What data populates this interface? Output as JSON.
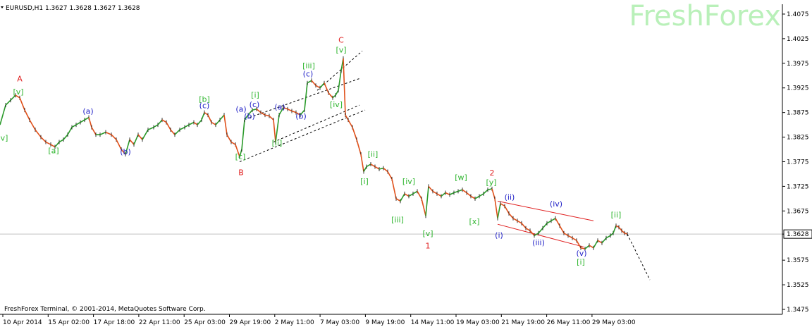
{
  "header": {
    "symbol_line": "EURUSD,H1  1.3627 1.3628 1.3627 1.3628"
  },
  "brand": {
    "logo_text": "FreshForex"
  },
  "footer": {
    "copyright": "FreshForex Terminal, © 2001-2014, MetaQuotes Software Corp."
  },
  "colors": {
    "bar_up": "#2a9a2a",
    "bar_down": "#e0501a",
    "wave_green": "#2db52d",
    "wave_blue": "#2424c8",
    "wave_red": "#e02020",
    "channel_red": "#e02020",
    "axis": "#000000",
    "brand": "#b9f0b9"
  },
  "chart_data": {
    "type": "line",
    "title": "EURUSD,H1",
    "ylim": [
      1.3465,
      1.4095
    ],
    "y_ticks": [
      "1.4075",
      "1.4025",
      "1.3975",
      "1.3925",
      "1.3875",
      "1.3825",
      "1.3775",
      "1.3725",
      "1.3675",
      "1.3628",
      "1.3575",
      "1.3525",
      "1.3475"
    ],
    "current_price": "1.3628",
    "x_ticks": [
      "10 Apr 2014",
      "15 Apr 02:00",
      "17 Apr 18:00",
      "22 Apr 11:00",
      "25 Apr 03:00",
      "29 Apr 19:00",
      "2 May 11:00",
      "7 May 03:00",
      "9 May 19:00",
      "14 May 11:00",
      "19 May 03:00",
      "21 May 19:00",
      "26 May 11:00",
      "29 May 03:00"
    ],
    "x_range": [
      0,
      1110
    ],
    "series": [
      {
        "values": [
          [
            0,
            1.385
          ],
          [
            8,
            1.389
          ],
          [
            15,
            1.39
          ],
          [
            22,
            1.391
          ],
          [
            28,
            1.3905
          ],
          [
            35,
            1.388
          ],
          [
            42,
            1.386
          ],
          [
            50,
            1.384
          ],
          [
            58,
            1.3825
          ],
          [
            65,
            1.3815
          ],
          [
            72,
            1.381
          ],
          [
            78,
            1.3805
          ],
          [
            84,
            1.3815
          ],
          [
            90,
            1.382
          ],
          [
            96,
            1.383
          ],
          [
            102,
            1.3845
          ],
          [
            108,
            1.385
          ],
          [
            114,
            1.3855
          ],
          [
            120,
            1.386
          ],
          [
            126,
            1.3865
          ],
          [
            130,
            1.3845
          ],
          [
            136,
            1.383
          ],
          [
            142,
            1.383
          ],
          [
            150,
            1.3835
          ],
          [
            158,
            1.383
          ],
          [
            165,
            1.382
          ],
          [
            172,
            1.38
          ],
          [
            178,
            1.379
          ],
          [
            184,
            1.382
          ],
          [
            190,
            1.381
          ],
          [
            196,
            1.383
          ],
          [
            202,
            1.382
          ],
          [
            210,
            1.384
          ],
          [
            218,
            1.3845
          ],
          [
            224,
            1.385
          ],
          [
            230,
            1.386
          ],
          [
            236,
            1.3855
          ],
          [
            242,
            1.384
          ],
          [
            248,
            1.383
          ],
          [
            255,
            1.384
          ],
          [
            262,
            1.3845
          ],
          [
            268,
            1.385
          ],
          [
            275,
            1.3855
          ],
          [
            280,
            1.385
          ],
          [
            286,
            1.386
          ],
          [
            290,
            1.3875
          ],
          [
            295,
            1.387
          ],
          [
            300,
            1.3855
          ],
          [
            306,
            1.385
          ],
          [
            312,
            1.386
          ],
          [
            318,
            1.387
          ],
          [
            322,
            1.383
          ],
          [
            328,
            1.3815
          ],
          [
            334,
            1.381
          ],
          [
            340,
            1.3785
          ],
          [
            343,
            1.38
          ],
          [
            347,
            1.386
          ],
          [
            352,
            1.387
          ],
          [
            358,
            1.388
          ],
          [
            364,
            1.3882
          ],
          [
            370,
            1.3875
          ],
          [
            376,
            1.387
          ],
          [
            382,
            1.3868
          ],
          [
            388,
            1.386
          ],
          [
            391,
            1.3815
          ],
          [
            396,
            1.387
          ],
          [
            402,
            1.3885
          ],
          [
            408,
            1.3882
          ],
          [
            414,
            1.3878
          ],
          [
            420,
            1.3875
          ],
          [
            426,
            1.387
          ],
          [
            432,
            1.388
          ],
          [
            436,
            1.3935
          ],
          [
            442,
            1.394
          ],
          [
            448,
            1.393
          ],
          [
            454,
            1.3925
          ],
          [
            460,
            1.3935
          ],
          [
            466,
            1.3915
          ],
          [
            472,
            1.3905
          ],
          [
            476,
            1.391
          ],
          [
            480,
            1.392
          ],
          [
            484,
            1.396
          ],
          [
            487,
            1.3985
          ],
          [
            490,
            1.387
          ],
          [
            494,
            1.386
          ],
          [
            500,
            1.3845
          ],
          [
            506,
            1.382
          ],
          [
            512,
            1.379
          ],
          [
            516,
            1.3755
          ],
          [
            520,
            1.3765
          ],
          [
            526,
            1.377
          ],
          [
            532,
            1.3765
          ],
          [
            538,
            1.376
          ],
          [
            544,
            1.3762
          ],
          [
            550,
            1.3755
          ],
          [
            556,
            1.374
          ],
          [
            562,
            1.37
          ],
          [
            568,
            1.3695
          ],
          [
            574,
            1.371
          ],
          [
            580,
            1.3705
          ],
          [
            586,
            1.371
          ],
          [
            592,
            1.3715
          ],
          [
            598,
            1.37
          ],
          [
            604,
            1.3665
          ],
          [
            608,
            1.3725
          ],
          [
            614,
            1.3715
          ],
          [
            620,
            1.371
          ],
          [
            626,
            1.3705
          ],
          [
            632,
            1.3712
          ],
          [
            638,
            1.3708
          ],
          [
            644,
            1.3712
          ],
          [
            650,
            1.3715
          ],
          [
            656,
            1.3718
          ],
          [
            662,
            1.3712
          ],
          [
            668,
            1.3705
          ],
          [
            674,
            1.37
          ],
          [
            680,
            1.3705
          ],
          [
            686,
            1.371
          ],
          [
            692,
            1.3718
          ],
          [
            698,
            1.372
          ],
          [
            702,
            1.37
          ],
          [
            706,
            1.366
          ],
          [
            710,
            1.369
          ],
          [
            716,
            1.3685
          ],
          [
            722,
            1.367
          ],
          [
            728,
            1.366
          ],
          [
            734,
            1.3655
          ],
          [
            740,
            1.365
          ],
          [
            746,
            1.364
          ],
          [
            752,
            1.3635
          ],
          [
            758,
            1.3625
          ],
          [
            764,
            1.363
          ],
          [
            770,
            1.364
          ],
          [
            776,
            1.365
          ],
          [
            782,
            1.3655
          ],
          [
            788,
            1.366
          ],
          [
            794,
            1.3645
          ],
          [
            800,
            1.363
          ],
          [
            806,
            1.3625
          ],
          [
            812,
            1.362
          ],
          [
            818,
            1.3615
          ],
          [
            824,
            1.36
          ],
          [
            830,
            1.3598
          ],
          [
            836,
            1.3605
          ],
          [
            842,
            1.36
          ],
          [
            848,
            1.3615
          ],
          [
            854,
            1.361
          ],
          [
            860,
            1.362
          ],
          [
            866,
            1.3625
          ],
          [
            870,
            1.363
          ],
          [
            874,
            1.3645
          ],
          [
            878,
            1.3642
          ],
          [
            882,
            1.3635
          ],
          [
            886,
            1.363
          ],
          [
            890,
            1.3628
          ]
        ]
      }
    ],
    "forecast": [
      [
        890,
        1.3628
      ],
      [
        922,
        1.3535
      ]
    ],
    "channels": [
      {
        "color": "black",
        "style": "dashed",
        "points": [
          [
            340,
            1.3775
          ],
          [
            518,
            1.388
          ]
        ]
      },
      {
        "color": "black",
        "style": "dashed",
        "points": [
          [
            354,
            1.3865
          ],
          [
            512,
            1.3945
          ]
        ]
      },
      {
        "color": "black",
        "style": "dashed",
        "points": [
          [
            388,
            1.3815
          ],
          [
            510,
            1.389
          ]
        ]
      },
      {
        "color": "black",
        "style": "dashed",
        "points": [
          [
            450,
            1.392
          ],
          [
            514,
            1.4
          ]
        ]
      },
      {
        "color": "red",
        "style": "solid",
        "points": [
          [
            706,
            1.3695
          ],
          [
            842,
            1.3655
          ]
        ]
      },
      {
        "color": "red",
        "style": "solid",
        "points": [
          [
            706,
            1.3648
          ],
          [
            828,
            1.3602
          ]
        ]
      }
    ],
    "annotations": [
      {
        "text": "A",
        "x": 28,
        "y": 1.3938,
        "color": "red"
      },
      {
        "text": "[v]",
        "x": 26,
        "y": 1.3912,
        "color": "green"
      },
      {
        "text": "v]",
        "x": 6,
        "y": 1.3818,
        "color": "green"
      },
      {
        "text": "[a]",
        "x": 76,
        "y": 1.3792,
        "color": "green"
      },
      {
        "text": "(a)",
        "x": 125,
        "y": 1.3872,
        "color": "blue"
      },
      {
        "text": "(b)",
        "x": 178,
        "y": 1.379,
        "color": "blue"
      },
      {
        "text": "[b]",
        "x": 290,
        "y": 1.3897,
        "color": "green"
      },
      {
        "text": "(c)",
        "x": 290,
        "y": 1.3884,
        "color": "blue"
      },
      {
        "text": "[c]",
        "x": 341,
        "y": 1.378,
        "color": "green"
      },
      {
        "text": "B",
        "x": 342,
        "y": 1.3748,
        "color": "red"
      },
      {
        "text": "(a)",
        "x": 342,
        "y": 1.3877,
        "color": "blue"
      },
      {
        "text": "(b)",
        "x": 354,
        "y": 1.3862,
        "color": "blue"
      },
      {
        "text": "(c)",
        "x": 361,
        "y": 1.3886,
        "color": "blue"
      },
      {
        "text": "[i]",
        "x": 362,
        "y": 1.3905,
        "color": "green"
      },
      {
        "text": "[ii]",
        "x": 393,
        "y": 1.3808,
        "color": "green"
      },
      {
        "text": "(a)",
        "x": 397,
        "y": 1.3881,
        "color": "blue"
      },
      {
        "text": "(b)",
        "x": 427,
        "y": 1.3862,
        "color": "blue"
      },
      {
        "text": "[iii]",
        "x": 438,
        "y": 1.3965,
        "color": "green"
      },
      {
        "text": "(c)",
        "x": 437,
        "y": 1.3948,
        "color": "blue"
      },
      {
        "text": "[iv]",
        "x": 477,
        "y": 1.3886,
        "color": "green"
      },
      {
        "text": "C",
        "x": 484,
        "y": 1.4017,
        "color": "red"
      },
      {
        "text": "[v]",
        "x": 484,
        "y": 1.3997,
        "color": "green"
      },
      {
        "text": "[i]",
        "x": 517,
        "y": 1.373,
        "color": "green"
      },
      {
        "text": "[ii]",
        "x": 529,
        "y": 1.3785,
        "color": "green"
      },
      {
        "text": "[iii]",
        "x": 564,
        "y": 1.3652,
        "color": "green"
      },
      {
        "text": "[iv]",
        "x": 580,
        "y": 1.373,
        "color": "green"
      },
      {
        "text": "[v]",
        "x": 607,
        "y": 1.3624,
        "color": "green"
      },
      {
        "text": "1",
        "x": 607,
        "y": 1.3599,
        "color": "red"
      },
      {
        "text": "[w]",
        "x": 654,
        "y": 1.3738,
        "color": "green"
      },
      {
        "text": "[x]",
        "x": 673,
        "y": 1.3648,
        "color": "green"
      },
      {
        "text": "2",
        "x": 698,
        "y": 1.3747,
        "color": "red"
      },
      {
        "text": "[y]",
        "x": 697,
        "y": 1.3728,
        "color": "green"
      },
      {
        "text": "(i)",
        "x": 708,
        "y": 1.362,
        "color": "blue"
      },
      {
        "text": "(ii)",
        "x": 723,
        "y": 1.3698,
        "color": "blue"
      },
      {
        "text": "(iii)",
        "x": 764,
        "y": 1.3605,
        "color": "blue"
      },
      {
        "text": "(iv)",
        "x": 789,
        "y": 1.3684,
        "color": "blue"
      },
      {
        "text": "(v)",
        "x": 825,
        "y": 1.3584,
        "color": "blue"
      },
      {
        "text": "[i]",
        "x": 824,
        "y": 1.3566,
        "color": "green"
      },
      {
        "text": "[ii]",
        "x": 874,
        "y": 1.3662,
        "color": "green"
      }
    ]
  }
}
